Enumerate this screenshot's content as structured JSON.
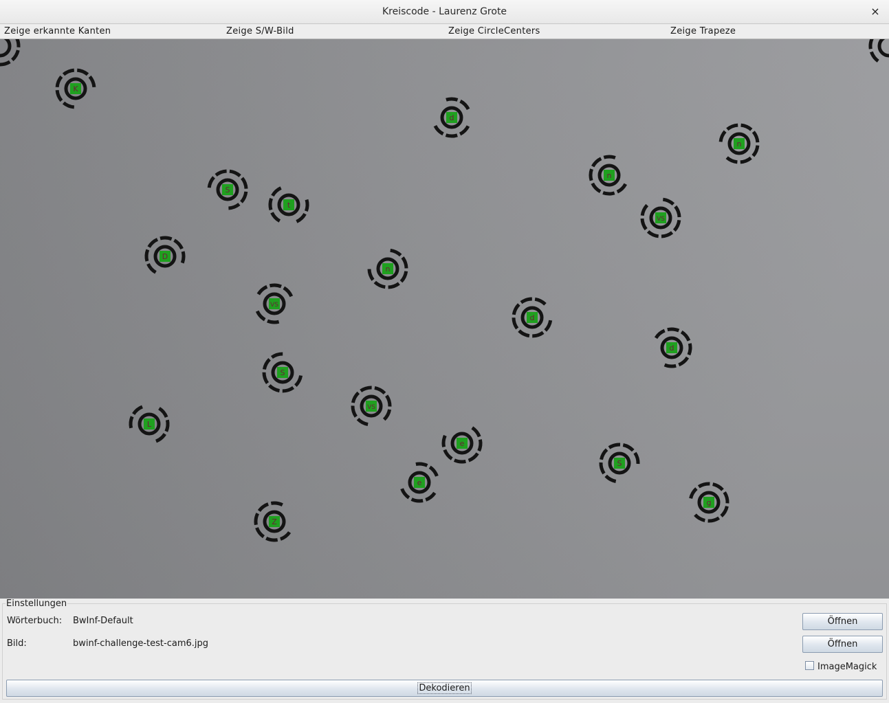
{
  "window": {
    "title": "Kreiscode - Laurenz Grote",
    "close_glyph": "×"
  },
  "menu": {
    "items": [
      "Zeige erkannte Kanten",
      "Zeige S/W-Bild",
      "Zeige CircleCenters",
      "Zeige Trapeze"
    ]
  },
  "image": {
    "background": "#8f9093",
    "marker_fill": "#1fa01f",
    "ring_color": "#141414",
    "markers": [
      {
        "label": "K"
      },
      {
        "label": "d"
      },
      {
        "label": "n"
      },
      {
        "label": "n"
      },
      {
        "label": "S"
      },
      {
        "label": "t"
      },
      {
        "label": "VS"
      },
      {
        "label": "D"
      },
      {
        "label": "n"
      },
      {
        "label": "VS"
      },
      {
        "label": "d"
      },
      {
        "label": "d"
      },
      {
        "label": "S"
      },
      {
        "label": "L"
      },
      {
        "label": "VS"
      },
      {
        "label": "e"
      },
      {
        "label": "S"
      },
      {
        "label": "e"
      },
      {
        "label": "g"
      },
      {
        "label": "Z"
      },
      {
        "label": ""
      },
      {
        "label": ""
      }
    ]
  },
  "settings": {
    "legend": "Einstellungen",
    "dictionary_label": "Wörterbuch:",
    "dictionary_value": "BwInf-Default",
    "image_label": "Bild:",
    "image_value": "bwinf-challenge-test-cam6.jpg",
    "open_button_1": "Öffnen",
    "open_button_2": "Öffnen",
    "imagemagick_label": "ImageMagick",
    "imagemagick_checked": false,
    "decode_button": "Dekodieren"
  }
}
